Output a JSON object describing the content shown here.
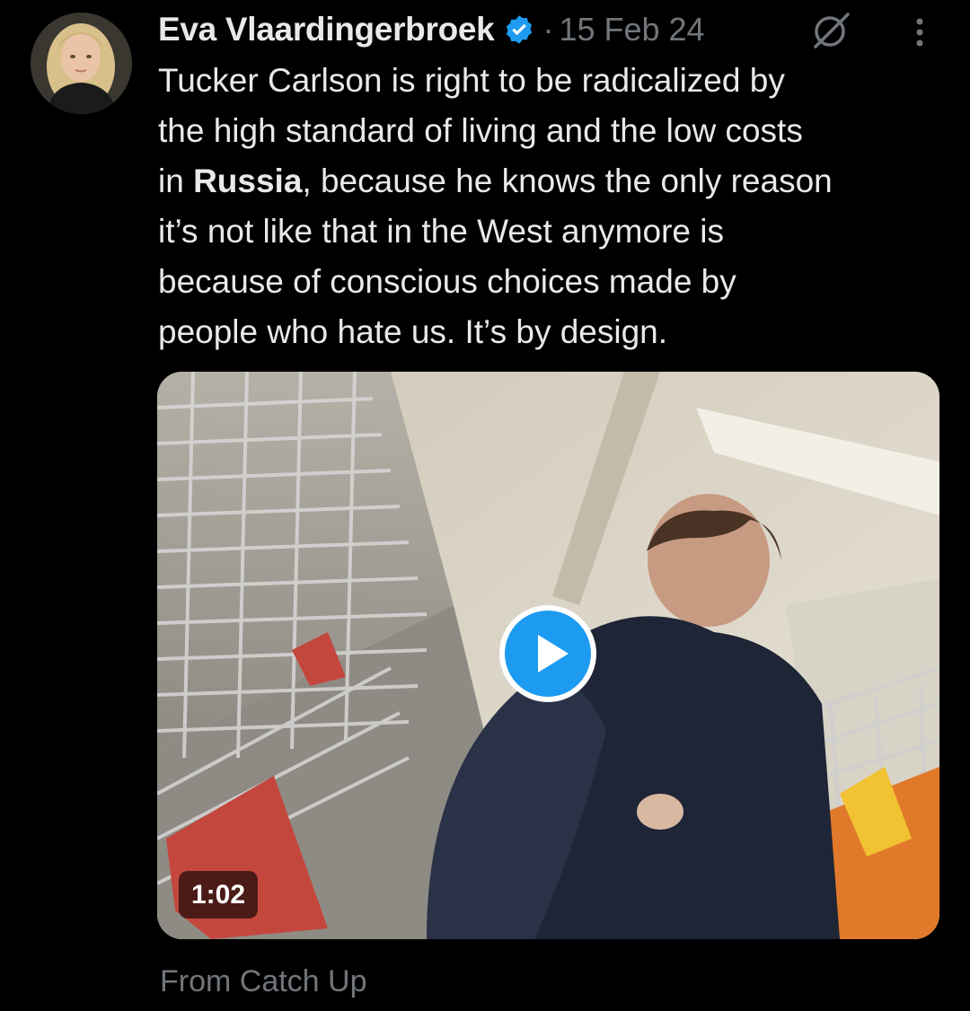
{
  "tweet": {
    "author_name": "Eva Vlaardingerbroek",
    "separator": "·",
    "date": "15 Feb 24",
    "text_lines": [
      [
        "Tucker Carlson is right to be radicalized by",
        "",
        ""
      ],
      [
        "the high standard of living and the low costs",
        "",
        ""
      ],
      [
        "in ",
        "Russia",
        ", because he knows the only reason"
      ],
      [
        "it’s not like that in the West anymore is",
        "",
        ""
      ],
      [
        "because of conscious choices made by",
        "",
        ""
      ],
      [
        "people who hate us. It’s by design.",
        "",
        ""
      ]
    ],
    "video": {
      "duration": "1:02"
    },
    "source_label": "From Catch Up"
  },
  "icons": {
    "verified": "verified-badge-icon",
    "grok": "grok-icon",
    "more": "more-vertical-icon",
    "play": "play-icon"
  },
  "colors": {
    "background": "#000000",
    "text": "#e7e9ea",
    "secondary": "#71767b",
    "accent": "#1d9bf0"
  }
}
